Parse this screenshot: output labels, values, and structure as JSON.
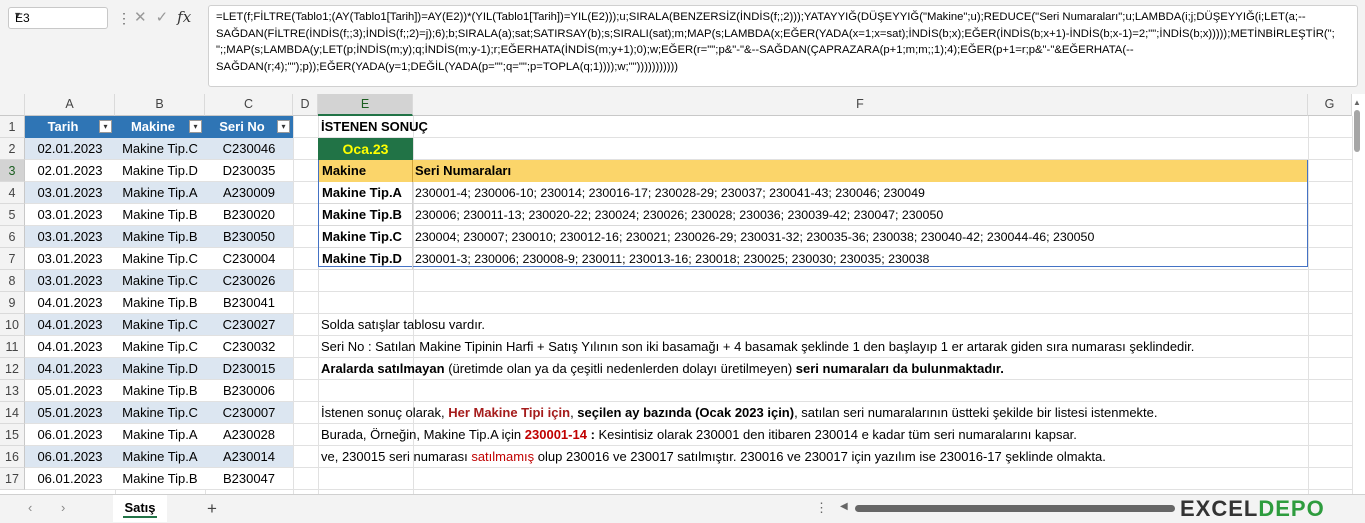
{
  "name_box": "E3",
  "formula_bar": {
    "formula": "=LET(f;FİLTRE(Tablo1;(AY(Tablo1[Tarih])=AY(E2))*(YIL(Tablo1[Tarih])=YIL(E2)));u;SIRALA(BENZERSİZ(İNDİS(f;;2)));YATAYYIĞ(DÜŞEYYIĞ(\"Makine\";u);REDUCE(\"Seri Numaraları\";u;LAMBDA(i;j;DÜŞEYYIĞ(i;LET(a;--SAĞDAN(FİLTRE(İNDİS(f;;3);İNDİS(f;;2)=j);6);b;SIRALA(a);sat;SATIRSAY(b);s;SIRALI(sat);m;MAP(s;LAMBDA(x;EĞER(YADA(x=1;x=sat);İNDİS(b;x);EĞER(İNDİS(b;x+1)-İNDİS(b;x-1)=2;\"\";İNDİS(b;x)))));METİNBİRLEŞTİR(\"; \";;MAP(s;LAMBDA(y;LET(p;İNDİS(m;y);q;İNDİS(m;y-1);r;EĞERHATA(İNDİS(m;y+1);0);w;EĞER(r=\"\";p&\"-\"&--SAĞDAN(ÇAPRAZARA(p+1;m;m;;1);4);EĞER(p+1=r;p&\"-\"&EĞERHATA(--SAĞDAN(r;4);\"\");p));EĞER(YADA(y=1;DEĞİL(YADA(p=\"\";q=\"\";p=TOPLA(q;1))));w;\"\")))))))))))",
    "fx_label": "fx"
  },
  "columns": [
    "A",
    "B",
    "C",
    "D",
    "E",
    "F",
    "G"
  ],
  "rows": [
    "1",
    "2",
    "3",
    "4",
    "5",
    "6",
    "7",
    "8",
    "9",
    "10",
    "11",
    "12",
    "13",
    "14",
    "15",
    "16",
    "17"
  ],
  "sales_table": {
    "headers": [
      "Tarih",
      "Makine",
      "Seri No"
    ],
    "rows": [
      [
        "02.01.2023",
        "Makine Tip.C",
        "C230046"
      ],
      [
        "02.01.2023",
        "Makine Tip.D",
        "D230035"
      ],
      [
        "03.01.2023",
        "Makine Tip.A",
        "A230009"
      ],
      [
        "03.01.2023",
        "Makine Tip.B",
        "B230020"
      ],
      [
        "03.01.2023",
        "Makine Tip.B",
        "B230050"
      ],
      [
        "03.01.2023",
        "Makine Tip.C",
        "C230004"
      ],
      [
        "03.01.2023",
        "Makine Tip.C",
        "C230026"
      ],
      [
        "04.01.2023",
        "Makine Tip.B",
        "B230041"
      ],
      [
        "04.01.2023",
        "Makine Tip.C",
        "C230027"
      ],
      [
        "04.01.2023",
        "Makine Tip.C",
        "C230032"
      ],
      [
        "04.01.2023",
        "Makine Tip.D",
        "D230015"
      ],
      [
        "05.01.2023",
        "Makine Tip.B",
        "B230006"
      ],
      [
        "05.01.2023",
        "Makine Tip.C",
        "C230007"
      ],
      [
        "06.01.2023",
        "Makine Tip.A",
        "A230028"
      ],
      [
        "06.01.2023",
        "Makine Tip.A",
        "A230014"
      ],
      [
        "06.01.2023",
        "Makine Tip.B",
        "B230047"
      ]
    ]
  },
  "result": {
    "title": "İSTENEN SONUÇ",
    "month": "Oca.23",
    "headers": [
      "Makine",
      "Seri Numaraları"
    ],
    "rows": [
      [
        "Makine Tip.A",
        "230001-4; 230006-10; 230014; 230016-17; 230028-29; 230037; 230041-43; 230046; 230049"
      ],
      [
        "Makine Tip.B",
        "230006; 230011-13; 230020-22; 230024; 230026; 230028; 230036; 230039-42; 230047; 230050"
      ],
      [
        "Makine Tip.C",
        "230004; 230007; 230010; 230012-16; 230021; 230026-29; 230031-32; 230035-36; 230038; 230040-42; 230044-46; 230050"
      ],
      [
        "Makine Tip.D",
        "230001-3; 230006; 230008-9; 230011; 230013-16; 230018; 230025; 230030; 230035; 230038"
      ]
    ]
  },
  "notes": {
    "r10": "Solda satışlar tablosu vardır.",
    "r11": "Seri No : Satılan Makine Tipinin Harfi + Satış Yılının son iki basamağı + 4 basamak şeklinde 1 den başlayıp 1 er artarak giden sıra numarası şeklindedir.",
    "r12a": "Aralarda satılmayan",
    "r12b": " (üretimde olan ya da çeşitli nedenlerden dolayı üretilmeyen) ",
    "r12c": "seri numaraları da bulunmaktadır.",
    "r14a": "İstenen sonuç olarak, ",
    "r14b": "Her Makine Tipi için",
    "r14c": ", ",
    "r14d": "seçilen ay bazında (Ocak 2023 için)",
    "r14e": ", satılan seri numaralarının üstteki şekilde bir listesi istenmekte.",
    "r15a": "Burada, Örneğin, Makine Tip.A için ",
    "r15b": "230001-14",
    "r15c": " : ",
    "r15d": "Kesintisiz olarak 230001 den itibaren 230014 e kadar tüm seri numaralarını kapsar.",
    "r16a": "ve, 230015 seri numarası ",
    "r16b": "satılmamış",
    "r16c": " olup 230016 ve 230017 satılmıştır. 230016 ve 230017 için yazılım ise 230016-17 şeklinde olmakta."
  },
  "sheet_tab": "Satış",
  "add_sheet": "+",
  "logo": {
    "text1": "EXCEL",
    "text2": "DEPO"
  },
  "colors": {
    "table_header": "#2f75b5",
    "band": "#dce6f1",
    "result_header": "#fbd56a",
    "month_bg": "#217346",
    "month_text": "#ffff00",
    "accent": "#217346"
  }
}
